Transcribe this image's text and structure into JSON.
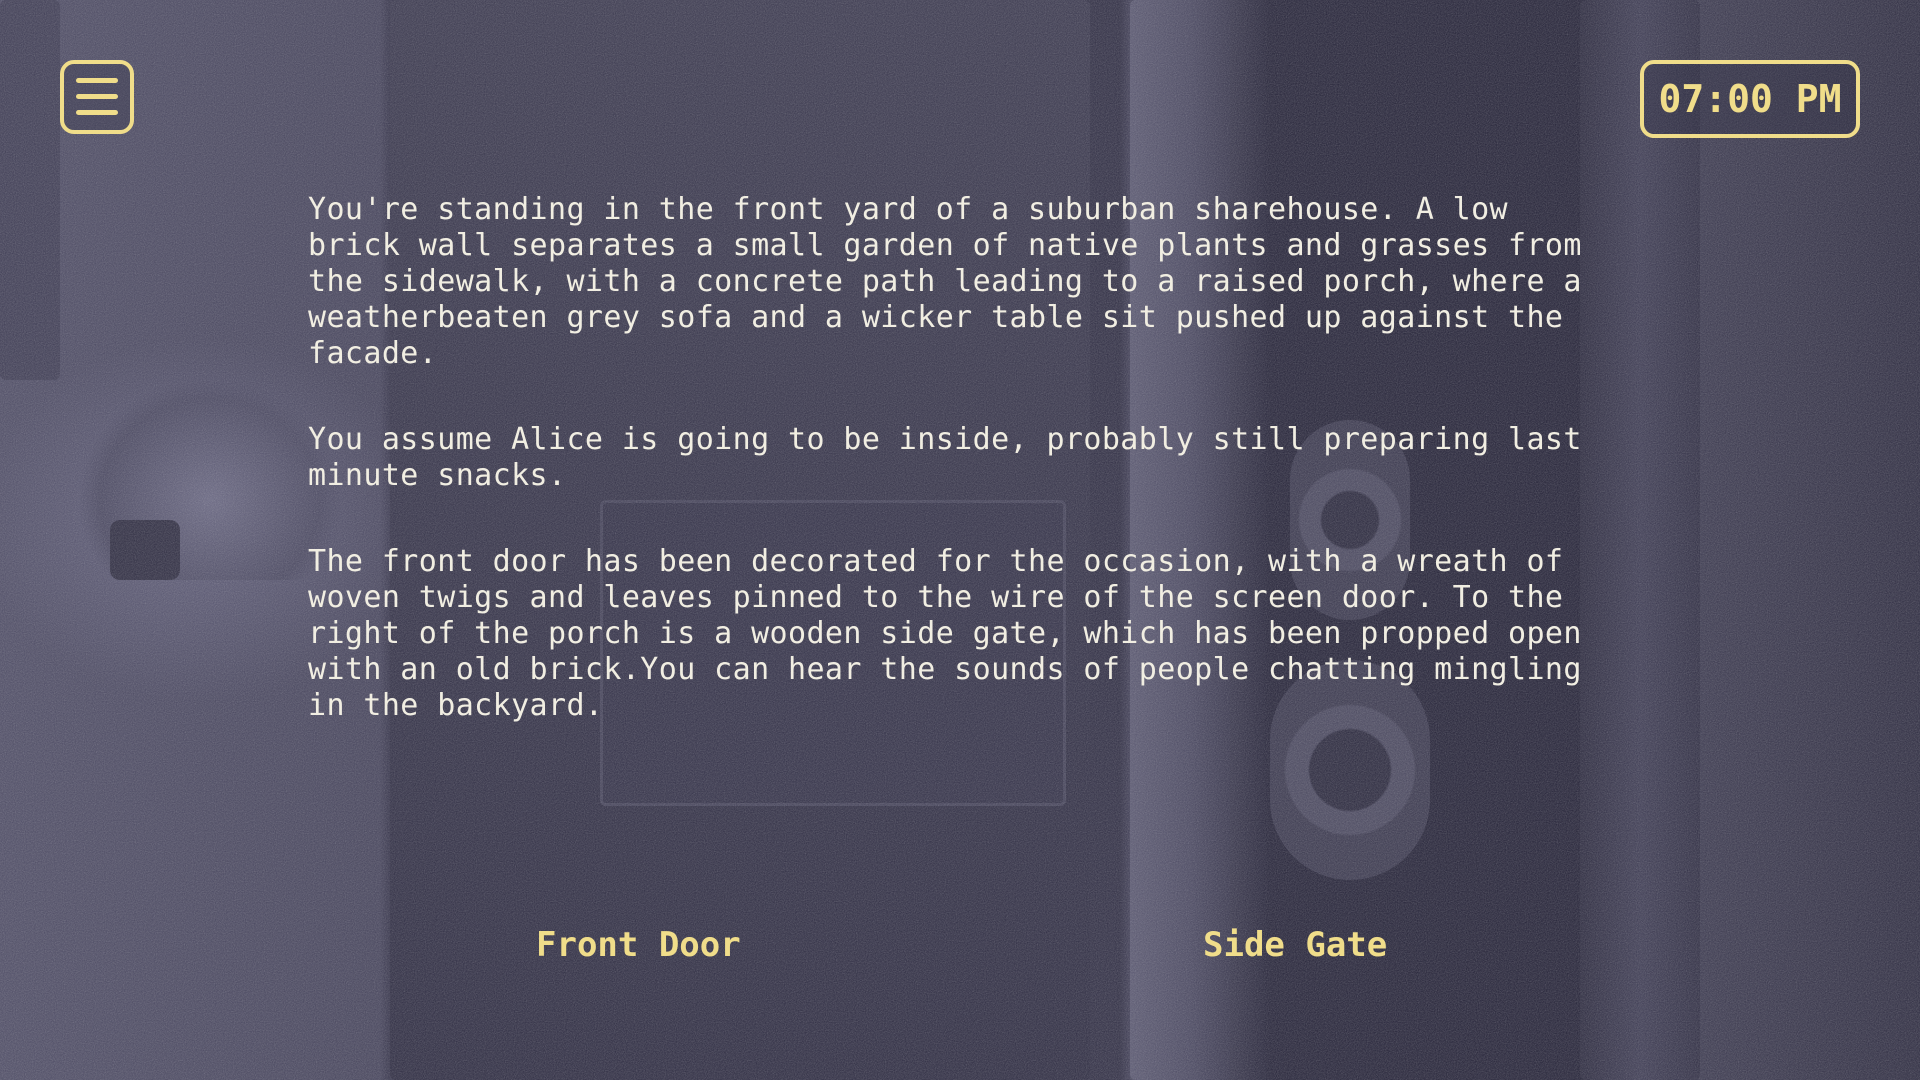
{
  "hud": {
    "menu_icon": "hamburger-menu-icon",
    "time": "07:00 PM"
  },
  "story": {
    "paragraphs": [
      "You're standing in the front yard of a suburban sharehouse. A low brick wall separates a small garden of native plants and grasses from the sidewalk, with a concrete path leading to a raised porch, where a weatherbeaten grey sofa and a wicker table sit pushed up against the facade.",
      "You assume Alice is going to be inside, probably still preparing last minute snacks.",
      "The front door has been decorated for the occasion, with a wreath of woven twigs and leaves pinned to the wire of the screen door. To the right of the porch is a wooden side gate, which has been propped open with an old brick.You can hear the sounds of people chatting mingling in the backyard."
    ]
  },
  "choices": [
    {
      "label": "Front Door"
    },
    {
      "label": "Side Gate"
    }
  ],
  "colors": {
    "accent": "#f0dd8a",
    "text": "#f1eee2",
    "background": "#2a2840"
  }
}
